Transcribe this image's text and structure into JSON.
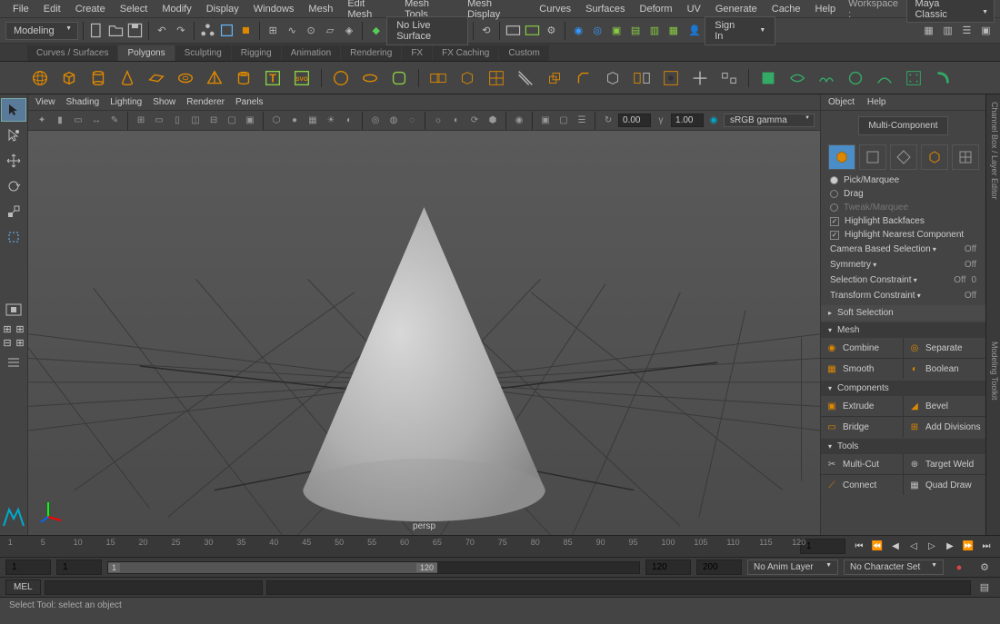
{
  "menubar": {
    "items": [
      "File",
      "Edit",
      "Create",
      "Select",
      "Modify",
      "Display",
      "Windows",
      "Mesh",
      "Edit Mesh",
      "Mesh Tools",
      "Mesh Display",
      "Curves",
      "Surfaces",
      "Deform",
      "UV",
      "Generate",
      "Cache",
      "Help"
    ],
    "workspace_label": "Workspace :",
    "workspace_value": "Maya Classic"
  },
  "toolbar": {
    "mode": "Modeling",
    "no_live_surface": "No Live Surface",
    "sign_in": "Sign In"
  },
  "shelf": {
    "tabs": [
      "Curves / Surfaces",
      "Polygons",
      "Sculpting",
      "Rigging",
      "Animation",
      "Rendering",
      "FX",
      "FX Caching",
      "Custom"
    ],
    "active_tab": 1
  },
  "viewport": {
    "menus": [
      "View",
      "Shading",
      "Lighting",
      "Show",
      "Renderer",
      "Panels"
    ],
    "num1": "0.00",
    "num2": "1.00",
    "gamma": "sRGB gamma",
    "camera": "persp"
  },
  "right_panel": {
    "menus": [
      "Object",
      "Help"
    ],
    "multi_component": "Multi-Component",
    "pick_marquee": "Pick/Marquee",
    "drag": "Drag",
    "tweak_marquee": "Tweak/Marquee",
    "highlight_backfaces": "Highlight Backfaces",
    "highlight_nearest": "Highlight Nearest Component",
    "camera_based": "Camera Based Selection",
    "camera_based_val": "Off",
    "symmetry": "Symmetry",
    "symmetry_val": "Off",
    "sel_constraint": "Selection Constraint",
    "sel_constraint_val": "Off",
    "sel_constraint_num": "0",
    "trans_constraint": "Transform Constraint",
    "trans_constraint_val": "Off",
    "soft_selection": "Soft Selection",
    "mesh_header": "Mesh",
    "mesh_tools": [
      [
        "Combine",
        "Separate"
      ],
      [
        "Smooth",
        "Boolean"
      ]
    ],
    "components_header": "Components",
    "component_tools": [
      [
        "Extrude",
        "Bevel"
      ],
      [
        "Bridge",
        "Add Divisions"
      ]
    ],
    "tools_header": "Tools",
    "tools_tools": [
      [
        "Multi-Cut",
        "Target Weld"
      ],
      [
        "Connect",
        "Quad Draw"
      ]
    ]
  },
  "side_tabs": [
    "Channel Box / Layer Editor",
    "Modeling Toolkit"
  ],
  "timeline": {
    "ticks": [
      1,
      5,
      10,
      15,
      20,
      25,
      30,
      35,
      40,
      45,
      50,
      55,
      60,
      65,
      70,
      75,
      80,
      85,
      90,
      95,
      100,
      105,
      110,
      115,
      120
    ],
    "current": "1",
    "range_start": "1",
    "range_end": "120",
    "range_start2": "1",
    "range_end_outer": "200",
    "range_handle": "1",
    "anim_layer": "No Anim Layer",
    "char_set": "No Character Set"
  },
  "cmd": {
    "mel": "MEL"
  },
  "status": "Select Tool: select an object"
}
